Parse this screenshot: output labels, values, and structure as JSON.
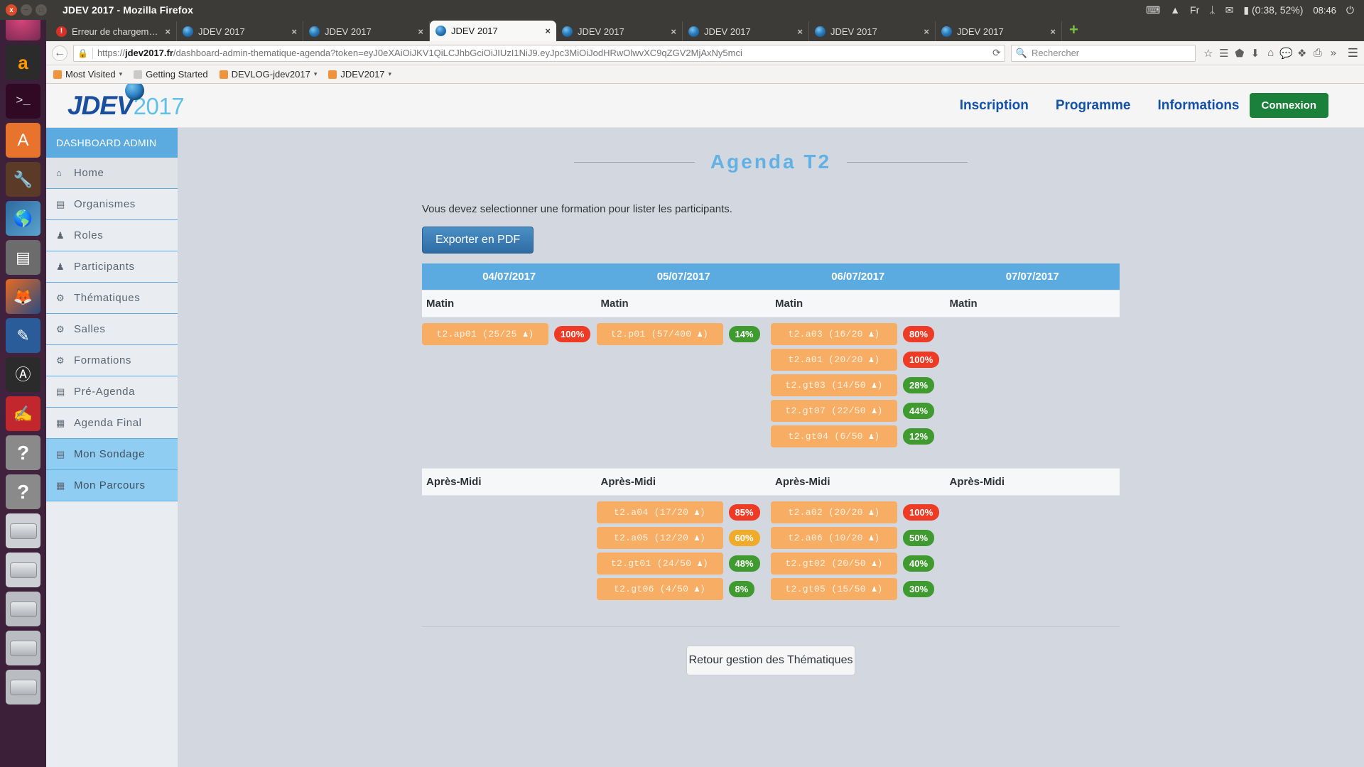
{
  "window": {
    "title": "JDEV 2017 - Mozilla Firefox",
    "close_glyph": "x",
    "min_glyph": "−",
    "max_glyph": "□"
  },
  "systray": {
    "items": [
      {
        "name": "keyboard-icon",
        "glyph": "⌨"
      },
      {
        "name": "wifi-icon",
        "glyph": "▲"
      },
      {
        "name": "language-indicator",
        "glyph": "Fr"
      },
      {
        "name": "bluetooth-icon",
        "glyph": "ᛦ"
      },
      {
        "name": "mail-icon",
        "glyph": "✉"
      },
      {
        "name": "battery-icon",
        "glyph": "▮"
      }
    ],
    "battery_text": "(0:38, 52%)",
    "clock": "08:46",
    "session_glyph": "⏻"
  },
  "tabs": [
    {
      "label": "Erreur de chargem…",
      "favicon": "error-icon",
      "active": false,
      "close": "×"
    },
    {
      "label": "JDEV 2017",
      "favicon": "site-icon",
      "active": false,
      "close": "×"
    },
    {
      "label": "JDEV 2017",
      "favicon": "site-icon",
      "active": false,
      "close": "×"
    },
    {
      "label": "JDEV 2017",
      "favicon": "site-icon",
      "active": true,
      "close": "×"
    },
    {
      "label": "JDEV 2017",
      "favicon": "site-icon",
      "active": false,
      "close": "×"
    },
    {
      "label": "JDEV 2017",
      "favicon": "site-icon",
      "active": false,
      "close": "×"
    },
    {
      "label": "JDEV 2017",
      "favicon": "site-icon",
      "active": false,
      "close": "×"
    },
    {
      "label": "JDEV 2017",
      "favicon": "site-icon",
      "active": false,
      "close": "×"
    }
  ],
  "newtab_label": "+",
  "navbar": {
    "back_glyph": "←",
    "lock_glyph": "🔒",
    "url_prefix": "https://",
    "url_domain": "jdev2017.fr",
    "url_rest": "/dashboard-admin-thematique-agenda?token=eyJ0eXAiOiJKV1QiLCJhbGciOiJIUzI1NiJ9.eyJpc3MiOiJodHRwOlwvXC9qZGV2MjAxNy5mci",
    "reload_glyph": "⟳",
    "search_placeholder": "Rechercher",
    "search_icon_glyph": "🔍",
    "tools": [
      {
        "name": "bookmark-star-icon",
        "glyph": "☆"
      },
      {
        "name": "reader-view-icon",
        "glyph": "☰"
      },
      {
        "name": "pocket-icon",
        "glyph": "⬟"
      },
      {
        "name": "downloads-icon",
        "glyph": "⬇"
      },
      {
        "name": "home-icon",
        "glyph": "⌂"
      },
      {
        "name": "chat-icon",
        "glyph": "💬"
      },
      {
        "name": "extension-icon",
        "glyph": "❖"
      },
      {
        "name": "save-page-icon",
        "glyph": "⎙"
      },
      {
        "name": "overflow-chevron-icon",
        "glyph": "»"
      }
    ],
    "menu_glyph": "☰"
  },
  "bookmarks": [
    {
      "label": "Most Visited",
      "icon": "star-folder-icon",
      "caret": "▾",
      "kind": "star"
    },
    {
      "label": "Getting Started",
      "icon": "doc-icon",
      "caret": "",
      "kind": "doc"
    },
    {
      "label": "DEVLOG-jdev2017",
      "icon": "feed-icon",
      "caret": "▾",
      "kind": "star"
    },
    {
      "label": "JDEV2017",
      "icon": "feed-icon",
      "caret": "▾",
      "kind": "star"
    }
  ],
  "site": {
    "logo_main": "JDEV",
    "logo_year": "2017",
    "nav": [
      {
        "label": "Inscription"
      },
      {
        "label": "Programme"
      },
      {
        "label": "Informations"
      }
    ],
    "login_button": "Connexion"
  },
  "sidebar": {
    "title": "DASHBOARD ADMIN",
    "items": [
      {
        "label": "Home",
        "icon": "house-icon",
        "glyph": "⌂",
        "state": "current"
      },
      {
        "label": "Organismes",
        "icon": "document-icon",
        "glyph": "▤",
        "state": "normal"
      },
      {
        "label": "Roles",
        "icon": "users-icon",
        "glyph": "♟",
        "state": "normal"
      },
      {
        "label": "Participants",
        "icon": "user-icon",
        "glyph": "♟",
        "state": "normal"
      },
      {
        "label": "Thématiques",
        "icon": "gears-icon",
        "glyph": "⚙",
        "state": "normal"
      },
      {
        "label": "Salles",
        "icon": "gears-icon",
        "glyph": "⚙",
        "state": "normal"
      },
      {
        "label": "Formations",
        "icon": "gears-icon",
        "glyph": "⚙",
        "state": "normal"
      },
      {
        "label": "Pré-Agenda",
        "icon": "calendar-icon",
        "glyph": "▤",
        "state": "normal"
      },
      {
        "label": "Agenda Final",
        "icon": "calendar-icon",
        "glyph": "▦",
        "state": "normal"
      },
      {
        "label": "Mon Sondage",
        "icon": "calendar-icon",
        "glyph": "▤",
        "state": "highlight"
      },
      {
        "label": "Mon Parcours",
        "icon": "calendar-icon",
        "glyph": "▦",
        "state": "highlight"
      }
    ]
  },
  "main": {
    "page_title": "Agenda T2",
    "hint": "Vous devez selectionner une formation pour lister les participants.",
    "export_button": "Exporter en PDF",
    "back_button": "Retour gestion des Thématiques",
    "days": [
      "04/07/2017",
      "05/07/2017",
      "06/07/2017",
      "07/07/2017"
    ],
    "slots": [
      {
        "label": [
          "Matin",
          "Matin",
          "Matin",
          "Matin"
        ],
        "columns": [
          [
            {
              "code": "t2.ap01",
              "count": "25/25",
              "percent": "100%",
              "badge": "red"
            }
          ],
          [
            {
              "code": "t2.p01",
              "count": "57/400",
              "percent": "14%",
              "badge": "green"
            }
          ],
          [
            {
              "code": "t2.a03",
              "count": "16/20",
              "percent": "80%",
              "badge": "red"
            },
            {
              "code": "t2.a01",
              "count": "20/20",
              "percent": "100%",
              "badge": "red"
            },
            {
              "code": "t2.gt03",
              "count": "14/50",
              "percent": "28%",
              "badge": "green"
            },
            {
              "code": "t2.gt07",
              "count": "22/50",
              "percent": "44%",
              "badge": "green"
            },
            {
              "code": "t2.gt04",
              "count": "6/50",
              "percent": "12%",
              "badge": "green"
            }
          ],
          []
        ]
      },
      {
        "label": [
          "Après-Midi",
          "Après-Midi",
          "Après-Midi",
          "Après-Midi"
        ],
        "columns": [
          [],
          [
            {
              "code": "t2.a04",
              "count": "17/20",
              "percent": "85%",
              "badge": "red"
            },
            {
              "code": "t2.a05",
              "count": "12/20",
              "percent": "60%",
              "badge": "orange"
            },
            {
              "code": "t2.gt01",
              "count": "24/50",
              "percent": "48%",
              "badge": "green"
            },
            {
              "code": "t2.gt06",
              "count": "4/50",
              "percent": "8%",
              "badge": "green"
            }
          ],
          [
            {
              "code": "t2.a02",
              "count": "20/20",
              "percent": "100%",
              "badge": "red"
            },
            {
              "code": "t2.a06",
              "count": "10/20",
              "percent": "50%",
              "badge": "green"
            },
            {
              "code": "t2.gt02",
              "count": "20/50",
              "percent": "40%",
              "badge": "green"
            },
            {
              "code": "t2.gt05",
              "count": "15/50",
              "percent": "30%",
              "badge": "green"
            }
          ],
          []
        ]
      }
    ],
    "person_glyph": "♟"
  },
  "colors": {
    "accent_blue": "#5babe0",
    "pill_orange": "#f7ad63",
    "badge_red": "#ee3b26",
    "badge_green": "#3f9b2f",
    "badge_orange": "#f0ab2b",
    "connexion_green": "#1b8039",
    "page_bg": "#d3d7df"
  },
  "launcher": [
    {
      "name": "launcher-ubuntu-dash",
      "glyph": "",
      "cls": "li-ubuntu"
    },
    {
      "name": "launcher-amazon",
      "glyph": "a",
      "cls": "li-amazon"
    },
    {
      "name": "launcher-terminal",
      "glyph": ">_",
      "cls": "li-term"
    },
    {
      "name": "launcher-files",
      "glyph": "A",
      "cls": "li-files"
    },
    {
      "name": "launcher-tools",
      "glyph": "🔧",
      "cls": "li-tools"
    },
    {
      "name": "launcher-world",
      "glyph": "🌎",
      "cls": "li-world"
    },
    {
      "name": "launcher-archive",
      "glyph": "▤",
      "cls": "li-arch"
    },
    {
      "name": "launcher-firefox",
      "glyph": "🦊",
      "cls": "li-fox"
    },
    {
      "name": "launcher-writer",
      "glyph": "✎",
      "cls": "li-writer"
    },
    {
      "name": "launcher-android",
      "glyph": "Ⓐ",
      "cls": "li-andro"
    },
    {
      "name": "launcher-signature",
      "glyph": "✍",
      "cls": "li-sign"
    },
    {
      "name": "launcher-help-1",
      "glyph": "?",
      "cls": "li-help"
    },
    {
      "name": "launcher-help-2",
      "glyph": "?",
      "cls": "li-help"
    },
    {
      "name": "launcher-disk-1",
      "glyph": "",
      "cls": "li-disk"
    },
    {
      "name": "launcher-disk-2",
      "glyph": "",
      "cls": "li-disk"
    },
    {
      "name": "launcher-disk-3",
      "glyph": "",
      "cls": "li-gray"
    },
    {
      "name": "launcher-disk-4",
      "glyph": "",
      "cls": "li-gray"
    },
    {
      "name": "launcher-disk-5",
      "glyph": "",
      "cls": "li-gray"
    }
  ]
}
